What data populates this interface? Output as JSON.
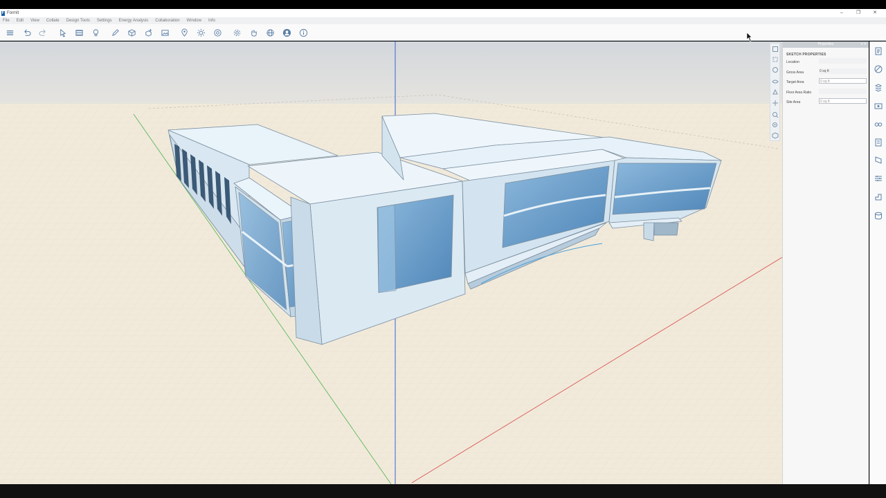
{
  "window": {
    "title": "FormIt",
    "controls": [
      "–",
      "❐",
      "✕"
    ]
  },
  "menu": {
    "items": [
      "File",
      "Edit",
      "View",
      "Collate",
      "Design Tools",
      "Settings",
      "Energy Analysis",
      "Collaboration",
      "Window",
      "Info"
    ]
  },
  "toolbar": {
    "buttons": [
      {
        "icon": "menu-icon"
      },
      {
        "icon": "undo-icon"
      },
      {
        "icon": "redo-icon"
      },
      {
        "icon": "select-arrow-icon"
      },
      {
        "icon": "level-icon"
      },
      {
        "icon": "lightbulb-icon"
      },
      {
        "icon": "pencil-icon"
      },
      {
        "icon": "cube-icon"
      },
      {
        "icon": "add-shape-icon"
      },
      {
        "icon": "image-import-icon"
      },
      {
        "icon": "location-pin-icon"
      },
      {
        "icon": "sun-icon"
      },
      {
        "icon": "camera-icon"
      },
      {
        "icon": "settings-gear-icon"
      },
      {
        "icon": "hand-pan-icon"
      },
      {
        "icon": "globe-icon"
      },
      {
        "icon": "user-account-icon"
      },
      {
        "icon": "info-icon"
      }
    ]
  },
  "properties_panel": {
    "header": "Properties",
    "header_controls": "▾ ✕",
    "section": "SKETCH PROPERTIES",
    "rows": [
      {
        "label": "Location",
        "value": ""
      },
      {
        "label": "Gross Area",
        "value": "0 sq ft"
      },
      {
        "label": "Target Area",
        "value": "0 sq ft"
      },
      {
        "label": "Floor Area Ratio",
        "value": ""
      },
      {
        "label": "Site Area",
        "value": "0 sq ft"
      }
    ]
  },
  "colors": {
    "ground": "#f1eadb",
    "sky": "#dcdfe3",
    "building_face": "#e2eef6",
    "glass": "#6fa3cf",
    "x_axis": "#d9534f",
    "y_axis": "#5cb85c",
    "z_axis": "#4a6fd1"
  }
}
